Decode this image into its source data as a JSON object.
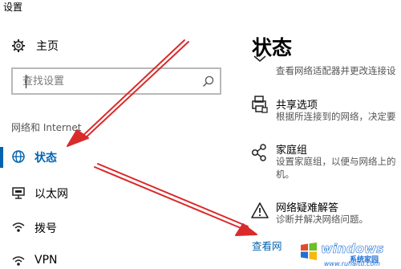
{
  "window": {
    "title": "设置"
  },
  "sidebar": {
    "home_label": "主页",
    "search": {
      "placeholder": "查找设置"
    },
    "section_header": "网络和 Internet",
    "items": [
      {
        "label": "状态",
        "icon": "globe-icon",
        "active": true
      },
      {
        "label": "以太网",
        "icon": "ethernet-icon",
        "active": false
      },
      {
        "label": "拨号",
        "icon": "dialup-icon",
        "active": false
      },
      {
        "label": "VPN",
        "icon": "vpn-icon",
        "active": false
      }
    ]
  },
  "main": {
    "title": "状态",
    "adapter_desc": "查看网络适配器并更改连接设",
    "options": [
      {
        "title": "共享选项",
        "desc": [
          "根据所连接到的网络，决定要"
        ],
        "icon": "printer-icon"
      },
      {
        "title": "家庭组",
        "desc": [
          "设置家庭组，以便与网络上的",
          "机。"
        ],
        "icon": "homegroup-icon"
      },
      {
        "title": "网络疑难解答",
        "desc": [
          "诊断并解决网络问题。"
        ],
        "icon": "warning-icon"
      }
    ],
    "link": "查看网"
  },
  "watermark": {
    "brand": "windows",
    "sub": "系统家园",
    "url": "www.ruhaitu.com"
  },
  "colors": {
    "accent": "#0063b1",
    "arrow": "#d92b2b"
  }
}
